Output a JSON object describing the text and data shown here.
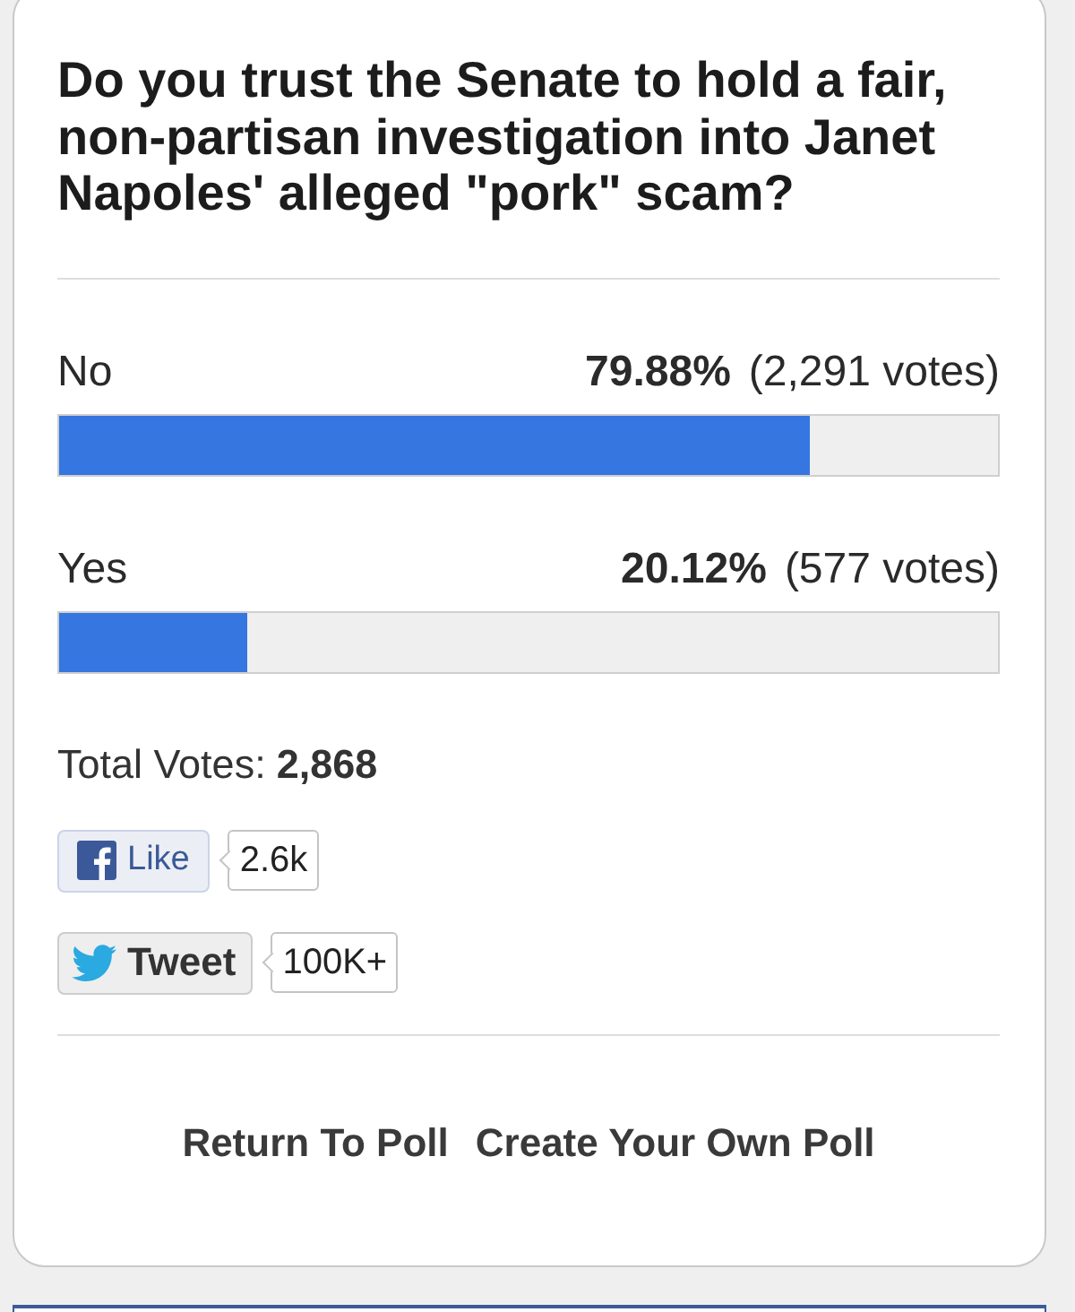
{
  "poll": {
    "question": "Do you trust the Senate to hold a fair, non-partisan investigation into Janet Napoles' alleged \"pork\" scam?",
    "options": [
      {
        "label": "No",
        "percent": "79.88%",
        "votes": "(2,291 votes)",
        "level": 0.7988
      },
      {
        "label": "Yes",
        "percent": "20.12%",
        "votes": "(577 votes)",
        "level": 0.2012
      }
    ],
    "total": {
      "label": "Total Votes:",
      "value": "2,868"
    },
    "social": [
      {
        "kind": "facebook",
        "label": "Like",
        "count": "2.6k"
      },
      {
        "kind": "twitter",
        "label": "Tweet",
        "count": "100K+"
      }
    ],
    "links": [
      "Return To Poll",
      "Create Your Own Poll"
    ]
  }
}
